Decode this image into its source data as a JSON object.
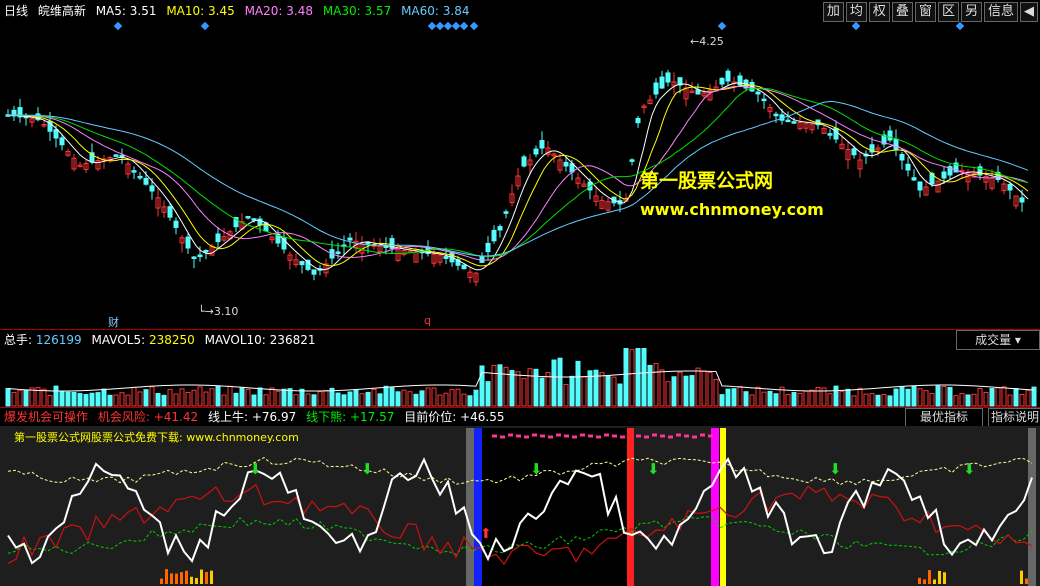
{
  "header": {
    "period": "日线",
    "stock_name": "皖维高新",
    "ma5": {
      "label": "MA5:",
      "value": "3.51",
      "color": "#ffffff"
    },
    "ma10": {
      "label": "MA10:",
      "value": "3.45",
      "color": "#ffff00"
    },
    "ma20": {
      "label": "MA20:",
      "value": "3.48",
      "color": "#ff80ff"
    },
    "ma30": {
      "label": "MA30:",
      "value": "3.57",
      "color": "#00e000"
    },
    "ma60": {
      "label": "MA60:",
      "value": "3.84",
      "color": "#66ccff"
    }
  },
  "toolbar": [
    "加",
    "均",
    "权",
    "叠",
    "窗",
    "区",
    "另",
    "信息",
    "◀"
  ],
  "price_chart": {
    "high_label": "4.25",
    "low_label": "3.10",
    "marker_cai": "财",
    "marker_q": "q",
    "watermark_title": "第一股票公式网",
    "watermark_url": "www.chnmoney.com"
  },
  "volume": {
    "total_label": "总手:",
    "total_value": "126199",
    "mavol5_label": "MAVOL5:",
    "mavol5_value": "238250",
    "mavol10_label": "MAVOL10:",
    "mavol10_value": "236821",
    "dropdown": "成交量"
  },
  "indicator": {
    "name": "爆发机会可操作",
    "risk_label": "机会风险:",
    "risk_value": "+41.42",
    "upper_label": "线上牛:",
    "upper_value": "+76.97",
    "lower_label": "线下熊:",
    "lower_value": "+17.57",
    "pos_label": "目前价位:",
    "pos_value": "+46.55",
    "best_button": "最优指标",
    "help_button": "指标说明",
    "subtitle": "第一股票公式网股票公式免费下载: www.chnmoney.com"
  }
}
